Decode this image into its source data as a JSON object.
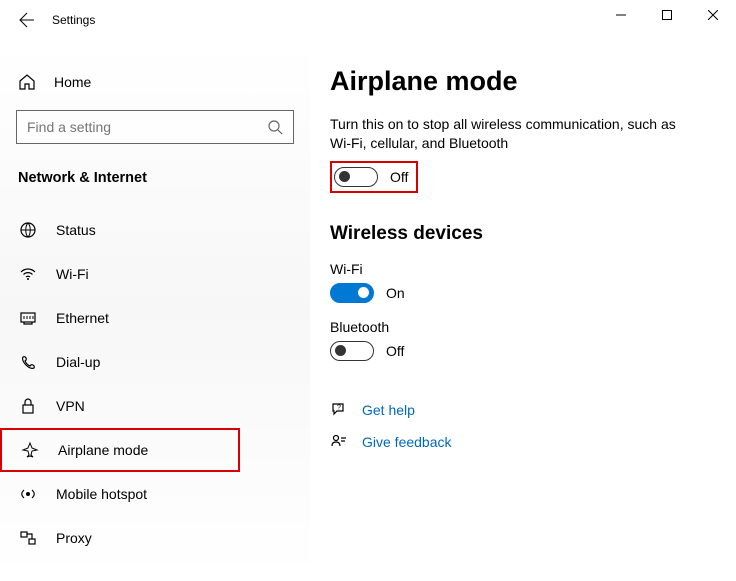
{
  "window": {
    "title": "Settings"
  },
  "sidebar": {
    "home_label": "Home",
    "search_placeholder": "Find a setting",
    "category_label": "Network & Internet",
    "items": [
      {
        "label": "Status"
      },
      {
        "label": "Wi-Fi"
      },
      {
        "label": "Ethernet"
      },
      {
        "label": "Dial-up"
      },
      {
        "label": "VPN"
      },
      {
        "label": "Airplane mode"
      },
      {
        "label": "Mobile hotspot"
      },
      {
        "label": "Proxy"
      }
    ]
  },
  "main": {
    "title": "Airplane mode",
    "description": "Turn this on to stop all wireless communication, such as Wi-Fi, cellular, and Bluetooth",
    "airplane_toggle_label": "Off",
    "wireless": {
      "section_title": "Wireless devices",
      "wifi_label": "Wi-Fi",
      "wifi_toggle_label": "On",
      "bt_label": "Bluetooth",
      "bt_toggle_label": "Off"
    },
    "help": {
      "get_help": "Get help",
      "give_feedback": "Give feedback"
    }
  }
}
